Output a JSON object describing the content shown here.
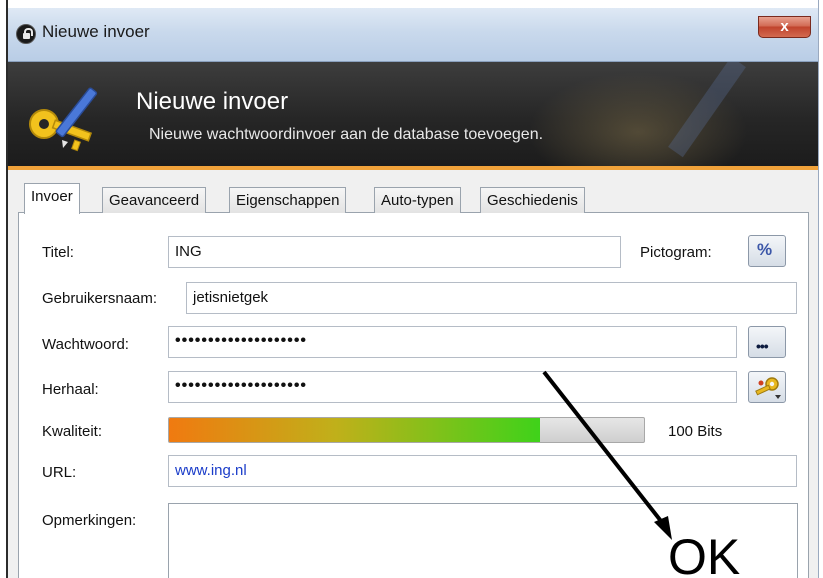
{
  "window": {
    "title": "Nieuwe invoer",
    "close_label": "x"
  },
  "banner": {
    "title": "Nieuwe invoer",
    "subtitle": "Nieuwe wachtwoordinvoer aan de database toevoegen."
  },
  "tabs": [
    {
      "label": "Invoer",
      "active": true
    },
    {
      "label": "Geavanceerd",
      "active": false
    },
    {
      "label": "Eigenschappen",
      "active": false
    },
    {
      "label": "Auto-typen",
      "active": false
    },
    {
      "label": "Geschiedenis",
      "active": false
    }
  ],
  "form": {
    "title_label": "Titel:",
    "title_value": "ING",
    "icon_label": "Pictogram:",
    "icon_button_glyph": "%",
    "username_label": "Gebruikersnaam:",
    "username_value": "jetisnietgek",
    "password_label": "Wachtwoord:",
    "password_value": "••••••••••••••••••••",
    "show_password_glyph": "•••",
    "repeat_label": "Herhaal:",
    "repeat_value": "••••••••••••••••••••",
    "quality_label": "Kwaliteit:",
    "quality_text": "100 Bits",
    "quality_fraction": 0.78,
    "url_label": "URL:",
    "url_value": "www.ing.nl",
    "notes_label": "Opmerkingen:",
    "notes_value": ""
  },
  "annotation": {
    "text": "OK"
  },
  "colors": {
    "banner_bg": "#262626",
    "banner_accent": "#f0a23a",
    "url_text": "#1a3cc9",
    "close_button": "#c0432d"
  }
}
